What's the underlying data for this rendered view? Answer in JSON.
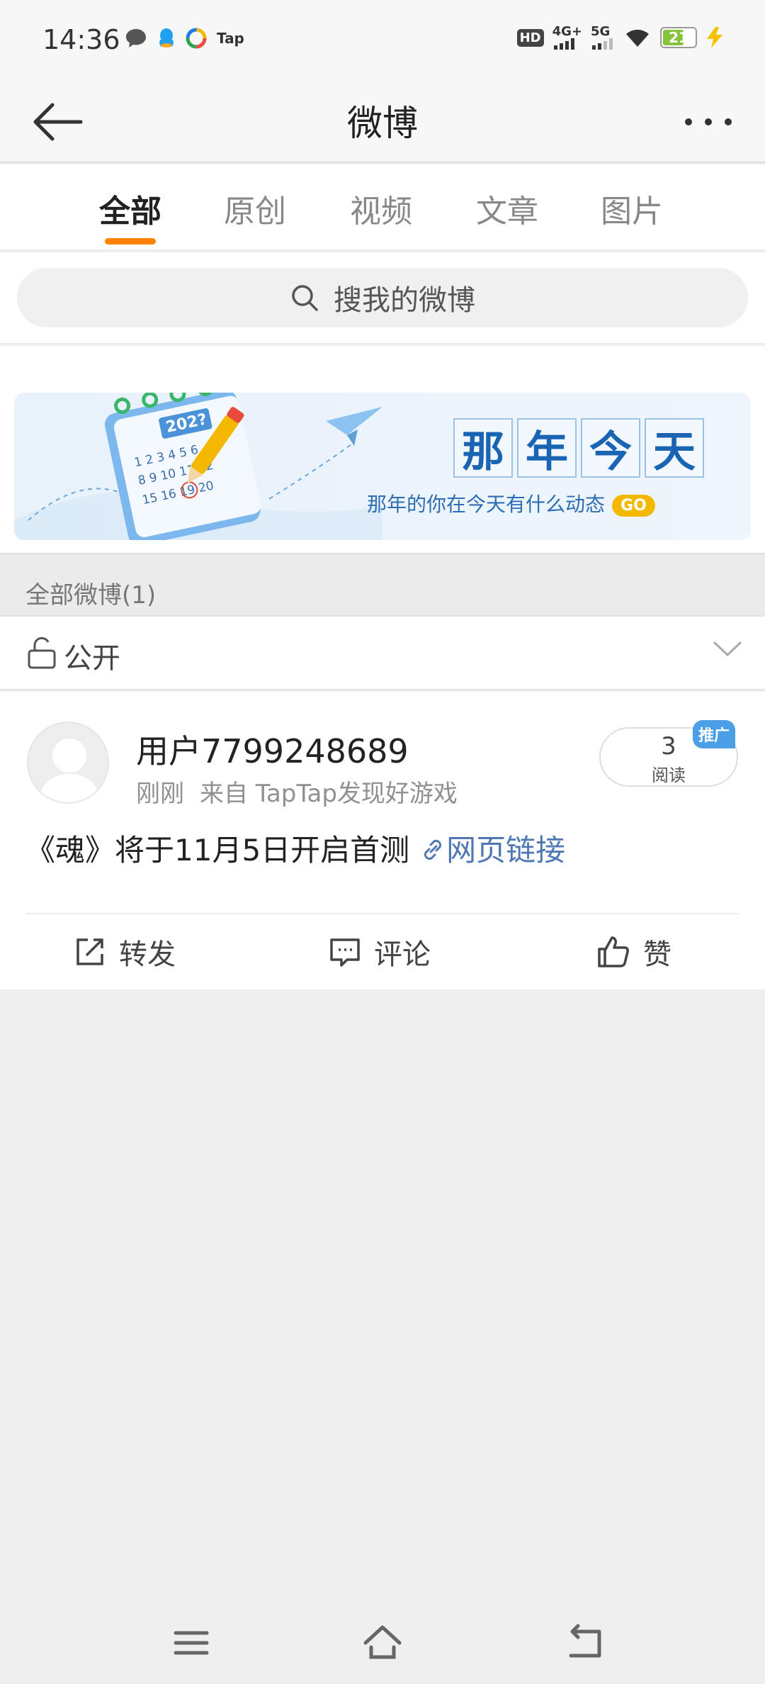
{
  "status_bar": {
    "time": "14:36",
    "tap_label": "Tap",
    "hd_label": "HD",
    "net_4g": "4G+",
    "net_5g": "5G",
    "battery": "21",
    "colors": {
      "battery_fill": "#86c23a",
      "charge": "#f5c400"
    }
  },
  "header": {
    "title": "微博",
    "back_icon": "arrow-left-icon",
    "more_icon": "more-dots-icon"
  },
  "tabs": [
    {
      "label": "全部",
      "active": true
    },
    {
      "label": "原创",
      "active": false
    },
    {
      "label": "视频",
      "active": false
    },
    {
      "label": "文章",
      "active": false
    },
    {
      "label": "图片",
      "active": false
    }
  ],
  "search": {
    "placeholder": "搜我的微博",
    "icon": "search-icon"
  },
  "banner": {
    "title_chars": [
      "那",
      "年",
      "今",
      "天"
    ],
    "subtitle": "那年的你在今天有什么动态",
    "go_label": "GO",
    "calendar_year": "202?"
  },
  "section": {
    "title": "全部微博(1)"
  },
  "filter": {
    "label": "公开",
    "icon": "unlock-icon"
  },
  "post": {
    "username": "用户7799248689",
    "time": "刚刚",
    "source": "来自 TapTap发现好游戏",
    "reads_count": "3",
    "reads_label": "阅读",
    "promo_badge": "推广",
    "text": "《魂》将于11月5日开启首测",
    "link_label": "网页链接",
    "actions": {
      "repost": "转发",
      "comment": "评论",
      "like": "赞"
    }
  },
  "colors": {
    "accent": "#ff8200",
    "link": "#4f77b4",
    "badge": "#4a9fe6"
  }
}
